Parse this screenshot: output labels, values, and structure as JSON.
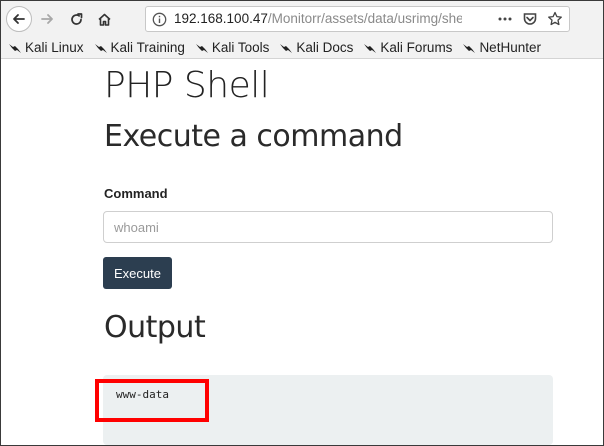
{
  "browser": {
    "url_host": "192.168.100.47",
    "url_path": "/Monitorr/assets/data/usrimg/she",
    "icons": [
      "back-arrow-icon",
      "forward-arrow-icon",
      "reload-icon",
      "home-icon",
      "info-icon",
      "more-icon",
      "pocket-icon",
      "star-icon",
      "kali-dragon-icon"
    ]
  },
  "bookmarks": [
    {
      "label": "Kali Linux"
    },
    {
      "label": "Kali Training"
    },
    {
      "label": "Kali Tools"
    },
    {
      "label": "Kali Docs"
    },
    {
      "label": "Kali Forums"
    },
    {
      "label": "NetHunter"
    }
  ],
  "page": {
    "title": "PHP Shell",
    "subtitle": "Execute a command",
    "command_label": "Command",
    "command_placeholder": "whoami",
    "execute_label": "Execute",
    "output_heading": "Output",
    "output_text": "www-data"
  },
  "colors": {
    "button_bg": "#2c3e50",
    "output_bg": "#ecf0f1",
    "highlight": "#ff0000"
  }
}
